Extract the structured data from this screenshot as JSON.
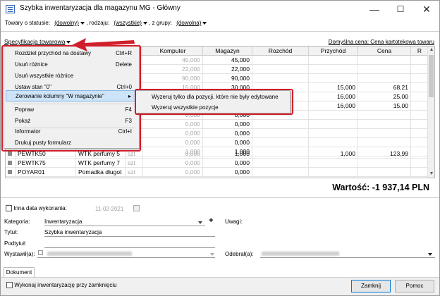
{
  "window": {
    "title": "Szybka inwentaryzacja dla magazynu MG - Główny",
    "minimize_label": "—",
    "maximize_label": "☐",
    "close_label": "✕"
  },
  "filters": {
    "status_label": "Towary o statusie:",
    "status_value": "(dowolny)",
    "kind_label": ", rodzaju:",
    "kind_value": "(wszystkie)",
    "group_label": ", z grupy:",
    "group_value": "(dowolna)"
  },
  "spec_link": "Specyfikacja towarowa",
  "default_price": "Domyślna cena: Cena kartotekowa towaru",
  "grid": {
    "headers": [
      "Komputer",
      "Magazyn",
      "Rozchód",
      "Przychód",
      "Cena",
      "R"
    ],
    "rows": [
      {
        "komp": "45,000",
        "mag": "45,000",
        "przy": "",
        "cena": ""
      },
      {
        "komp": "22,000",
        "mag": "22,000",
        "przy": "",
        "cena": ""
      },
      {
        "komp": "90,000",
        "mag": "90,000",
        "przy": "",
        "cena": ""
      },
      {
        "komp": "15,000",
        "mag": "30,000",
        "przy": "15,000",
        "cena": "68,21"
      },
      {
        "komp": "",
        "mag": "",
        "przy": "16,000",
        "cena": "25,00"
      },
      {
        "komp": "",
        "mag": "",
        "przy": "16,000",
        "cena": "15,00"
      },
      {
        "komp": "0,000",
        "mag": "0,000",
        "przy": "",
        "cena": ""
      },
      {
        "komp": "0,000",
        "mag": "0,000",
        "przy": "",
        "cena": ""
      },
      {
        "komp": "0,000",
        "mag": "0,000",
        "przy": "",
        "cena": ""
      },
      {
        "komp": "0,000",
        "mag": "0,000",
        "przy": "",
        "cena": ""
      },
      {
        "komp": "1,000",
        "mag": "1,000",
        "przy": "",
        "cena": ""
      }
    ],
    "named_rows": [
      {
        "code": "PEWTK50",
        "name": "WTK perfumy 5",
        "unit": "szt",
        "komp": "0,000",
        "mag": "1,000",
        "przy": "1,000",
        "cena": "123,99"
      },
      {
        "code": "PEWTK75",
        "name": "WTK perfumy 7",
        "unit": "szt",
        "komp": "0,000",
        "mag": "0,000",
        "przy": "",
        "cena": ""
      },
      {
        "code": "POYAR01",
        "name": "Pomadka długot",
        "unit": "szt",
        "komp": "0,000",
        "mag": "0,000",
        "przy": "",
        "cena": ""
      }
    ]
  },
  "menu": {
    "items": [
      {
        "label": "Rozdziel przychód na dostawy",
        "shortcut": "Ctrl+R"
      },
      {
        "label": "Usuń różnice",
        "shortcut": "Delete"
      },
      {
        "label": "Usuń wszystkie różnice",
        "shortcut": ""
      },
      {
        "label": "Ustaw stan \"0\"",
        "shortcut": "Ctrl+0"
      },
      {
        "label": "Zerowanie kolumny \"W magazynie\"",
        "shortcut": "▸"
      },
      {
        "label": "Popraw",
        "shortcut": "F4"
      },
      {
        "label": "Pokaż",
        "shortcut": "F3"
      },
      {
        "label": "Informator",
        "shortcut": "Ctrl+I"
      },
      {
        "label": "Drukuj pusty formularz",
        "shortcut": ""
      }
    ]
  },
  "submenu": {
    "items": [
      "Wyzeruj tylko dla pozycji, które nie były edytowane",
      "Wyzeruj wszystkie pozycje"
    ]
  },
  "total": "Wartość: -1 937,14 PLN",
  "form": {
    "other_date_label": "Inna data wykonania:",
    "date_value": "11-02-2021",
    "category_label": "Kategoria:",
    "category_value": "Inwentaryzacja",
    "remarks_label": "Uwagi:",
    "title_label": "Tytuł:",
    "title_value": "Szybka inwentaryzacja",
    "subtitle_label": "Podtytuł:",
    "issued_label": "Wystawił(a):",
    "received_label": "Odebrał(a):",
    "plus": "+"
  },
  "tab": "Dokument",
  "footer": {
    "execute_on_close": "Wykonaj inwentaryzację przy zamknięciu",
    "close_button": "Zamknij",
    "help_button": "Pomoc"
  },
  "colors": {
    "accent_red": "#d01f2a",
    "highlight": "#cde3f7"
  }
}
